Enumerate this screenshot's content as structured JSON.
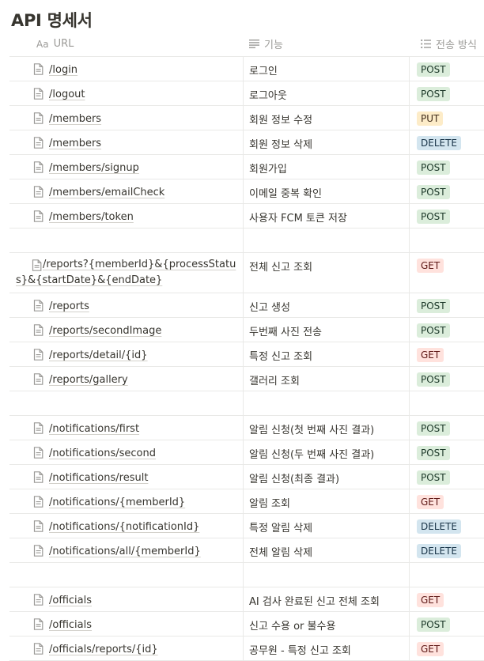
{
  "page": {
    "title": "API 명세서"
  },
  "columns": {
    "url": "URL",
    "url_prefix": "Aa",
    "feature": "기능",
    "method": "전송 방식"
  },
  "method_colors": {
    "POST": "#dbeddb",
    "PUT": "#fdecc8",
    "DELETE": "#d3e5ef",
    "GET": "#ffe2dd"
  },
  "rows": [
    {
      "url": "/login",
      "feature": "로그인",
      "method": "POST"
    },
    {
      "url": "/logout",
      "feature": "로그아웃",
      "method": "POST"
    },
    {
      "url": "/members",
      "feature": "회원 정보 수정",
      "method": "PUT"
    },
    {
      "url": "/members",
      "feature": "회원 정보 삭제",
      "method": "DELETE"
    },
    {
      "url": "/members/signup",
      "feature": "회원가입",
      "method": "POST"
    },
    {
      "url": "/members/emailCheck",
      "feature": "이메일 중복 확인",
      "method": "POST"
    },
    {
      "url": "/members/token",
      "feature": "사용자 FCM 토큰 저장",
      "method": "POST"
    },
    {
      "url": "",
      "feature": "",
      "method": ""
    },
    {
      "url": "/reports?{memberId}&{processStatus}&{startDate}&{endDate}",
      "feature": "전체 신고 조회",
      "method": "GET",
      "tall": true
    },
    {
      "url": "/reports",
      "feature": "신고 생성",
      "method": "POST"
    },
    {
      "url": "/reports/secondImage",
      "feature": "두번째 사진 전송",
      "method": "POST"
    },
    {
      "url": "/reports/detail/{id}",
      "feature": "특정 신고 조회",
      "method": "GET"
    },
    {
      "url": "/reports/gallery",
      "feature": "갤러리 조회",
      "method": "POST"
    },
    {
      "url": "",
      "feature": "",
      "method": ""
    },
    {
      "url": "/notifications/first",
      "feature": "알림 신청(첫 번째 사진 결과)",
      "method": "POST"
    },
    {
      "url": "/notifications/second",
      "feature": "알림 신청(두 번째 사진 결과)",
      "method": "POST"
    },
    {
      "url": "/notifications/result",
      "feature": "알림 신청(최종 결과)",
      "method": "POST"
    },
    {
      "url": "/notifications/{memberId}",
      "feature": "알림 조회",
      "method": "GET"
    },
    {
      "url": "/notifications/{notificationId}",
      "feature": "특정 알림 삭제",
      "method": "DELETE"
    },
    {
      "url": "/notifications/all/{memberId}",
      "feature": "전체 알림 삭제",
      "method": "DELETE"
    },
    {
      "url": "",
      "feature": "",
      "method": ""
    },
    {
      "url": "/officials",
      "feature": "AI 검사 완료된 신고 전체 조회",
      "method": "GET"
    },
    {
      "url": "/officials",
      "feature": "신고 수용 or 불수용",
      "method": "POST"
    },
    {
      "url": "/officials/reports/{id}",
      "feature": "공무원 - 특정 신고 조회",
      "method": "GET"
    }
  ]
}
